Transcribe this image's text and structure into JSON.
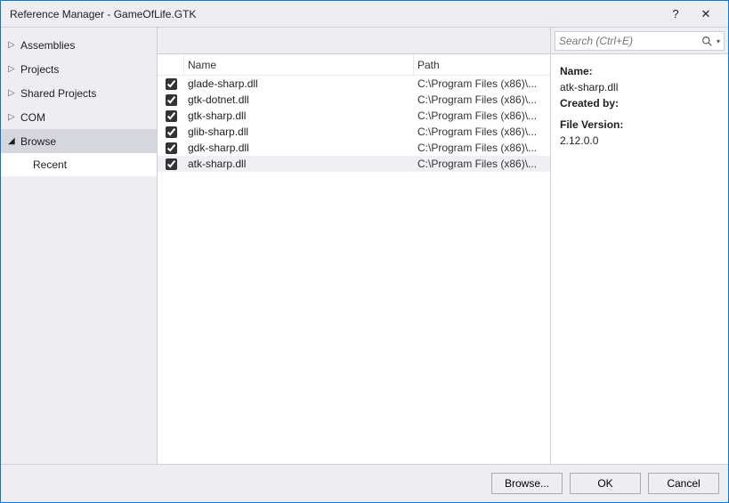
{
  "window": {
    "title": "Reference Manager - GameOfLife.GTK",
    "help_glyph": "?",
    "close_glyph": "✕"
  },
  "nav": {
    "items": [
      {
        "label": "Assemblies",
        "expanded": false
      },
      {
        "label": "Projects",
        "expanded": false
      },
      {
        "label": "Shared Projects",
        "expanded": false
      },
      {
        "label": "COM",
        "expanded": false
      },
      {
        "label": "Browse",
        "expanded": true,
        "selected": true,
        "children": [
          {
            "label": "Recent"
          }
        ]
      }
    ]
  },
  "search": {
    "placeholder": "Search (Ctrl+E)"
  },
  "columns": {
    "name": "Name",
    "path": "Path"
  },
  "refs": [
    {
      "checked": true,
      "name": "glade-sharp.dll",
      "path": "C:\\Program Files (x86)\\..."
    },
    {
      "checked": true,
      "name": "gtk-dotnet.dll",
      "path": "C:\\Program Files (x86)\\..."
    },
    {
      "checked": true,
      "name": "gtk-sharp.dll",
      "path": "C:\\Program Files (x86)\\..."
    },
    {
      "checked": true,
      "name": "glib-sharp.dll",
      "path": "C:\\Program Files (x86)\\..."
    },
    {
      "checked": true,
      "name": "gdk-sharp.dll",
      "path": "C:\\Program Files (x86)\\..."
    },
    {
      "checked": true,
      "name": "atk-sharp.dll",
      "path": "C:\\Program Files (x86)\\...",
      "selected": true
    }
  ],
  "details": {
    "name_label": "Name:",
    "name_value": "atk-sharp.dll",
    "createdby_label": "Created by:",
    "createdby_value": "",
    "fileversion_label": "File Version:",
    "fileversion_value": "2.12.0.0"
  },
  "buttons": {
    "browse": "Browse...",
    "ok": "OK",
    "cancel": "Cancel"
  }
}
